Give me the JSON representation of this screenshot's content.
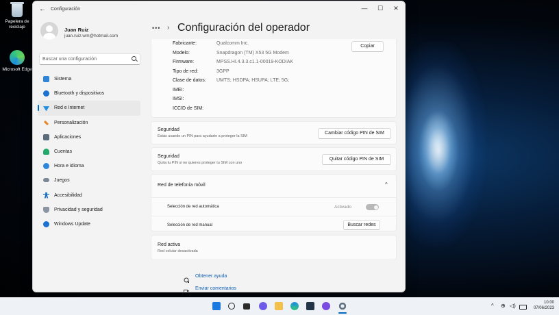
{
  "desktop": {
    "icons": [
      {
        "label": "Papelera de reciclaje"
      },
      {
        "label": "Microsoft Edge"
      }
    ]
  },
  "window": {
    "app_title": "Configuración",
    "controls": {
      "minimize": "—",
      "maximize": "☐",
      "close": "✕"
    }
  },
  "profile": {
    "name": "Juan Ruiz",
    "email": "juan.ruiz.wm@hotmail.com"
  },
  "search": {
    "placeholder": "Buscar una configuración"
  },
  "nav": {
    "items": [
      {
        "label": "Sistema",
        "color": "#2f86d9"
      },
      {
        "label": "Bluetooth y dispositivos",
        "color": "#1a73d1"
      },
      {
        "label": "Red e Internet",
        "color": "#1e8fe1",
        "active": true
      },
      {
        "label": "Personalización",
        "color": "#e3892b"
      },
      {
        "label": "Aplicaciones",
        "color": "#5a6b7b"
      },
      {
        "label": "Cuentas",
        "color": "#23a96b"
      },
      {
        "label": "Hora e idioma",
        "color": "#2f86d9"
      },
      {
        "label": "Juegos",
        "color": "#7b8896"
      },
      {
        "label": "Accesibilidad",
        "color": "#1b6ec2"
      },
      {
        "label": "Privacidad y seguridad",
        "color": "#8a96a3"
      },
      {
        "label": "Windows Update",
        "color": "#1a73d1"
      }
    ]
  },
  "breadcrumb": {
    "dots": "•••",
    "chevron": "›"
  },
  "page_title": "Configuración del operador",
  "info": {
    "rows": [
      {
        "key": "Fabricante:",
        "value": "Qualcomm Inc."
      },
      {
        "key": "Modelo:",
        "value": "Snapdragon (TM) X53 5G Modem"
      },
      {
        "key": "Firmware:",
        "value": "MPSS.HI.4.3.3.c1.1-00019-KODIAK"
      },
      {
        "key": "Tipo de red:",
        "value": "3GPP"
      },
      {
        "key": "Clase de datos:",
        "value": "UMTS; HSDPA; HSUPA; LTE; 5G;"
      },
      {
        "key": "IMEI:",
        "value": ""
      },
      {
        "key": "IMSI:",
        "value": ""
      },
      {
        "key": "ICCID de SIM:",
        "value": ""
      }
    ],
    "copy_button": "Copiar"
  },
  "security1": {
    "title": "Seguridad",
    "subtitle": "Estás usando un PIN para ayudarte a proteger la SIM",
    "button": "Cambiar código PIN de SIM"
  },
  "security2": {
    "title": "Seguridad",
    "subtitle": "Quita tu PIN si no quieres proteger tu SIM con uno",
    "button": "Quitar código PIN de SIM"
  },
  "mobile_network": {
    "title": "Red de telefonía móvil",
    "chevron": "^",
    "auto_label": "Selección de red automática",
    "auto_state": "Activado",
    "manual_label": "Selección de red manual",
    "search_button": "Buscar redes"
  },
  "active_network": {
    "title": "Red activa",
    "subtitle": "Red celular desactivada"
  },
  "footer": {
    "help": "Obtener ayuda",
    "feedback": "Enviar comentarios"
  },
  "taskbar": {
    "tray_chevron": "^",
    "time": "10:00",
    "date": "07/06/2023"
  }
}
